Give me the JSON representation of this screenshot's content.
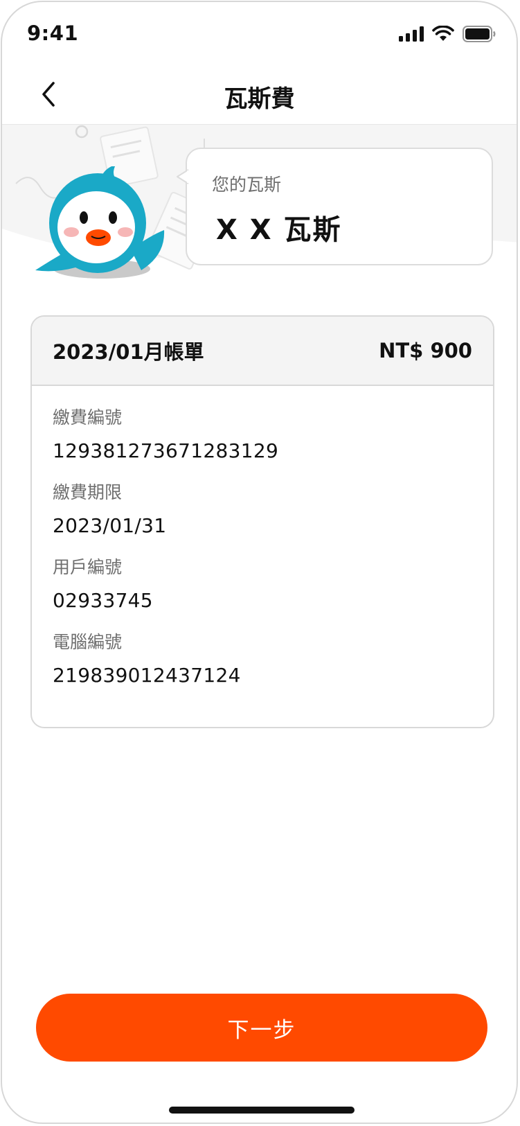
{
  "status_bar": {
    "time": "9:41",
    "icons": [
      "cellular-signal-icon",
      "wifi-icon",
      "battery-icon"
    ]
  },
  "nav": {
    "back_icon": "chevron-left-icon",
    "title": "瓦斯費"
  },
  "hero": {
    "label": "您的瓦斯",
    "provider_name": "X X 瓦斯"
  },
  "bill": {
    "period": "2023/01月帳單",
    "amount": "NT$ 900",
    "fields": [
      {
        "label": "繳費編號",
        "value": "129381273671283129"
      },
      {
        "label": "繳費期限",
        "value": "2023/01/31"
      },
      {
        "label": "用戶編號",
        "value": "02933745"
      },
      {
        "label": "電腦編號",
        "value": "219839012437124"
      }
    ]
  },
  "actions": {
    "next_label": "下一步"
  },
  "colors": {
    "accent": "#ff4a00",
    "mascot_body": "#1aa9c7",
    "card_header_bg": "#f4f4f4",
    "label_gray": "#6f6f6f"
  }
}
